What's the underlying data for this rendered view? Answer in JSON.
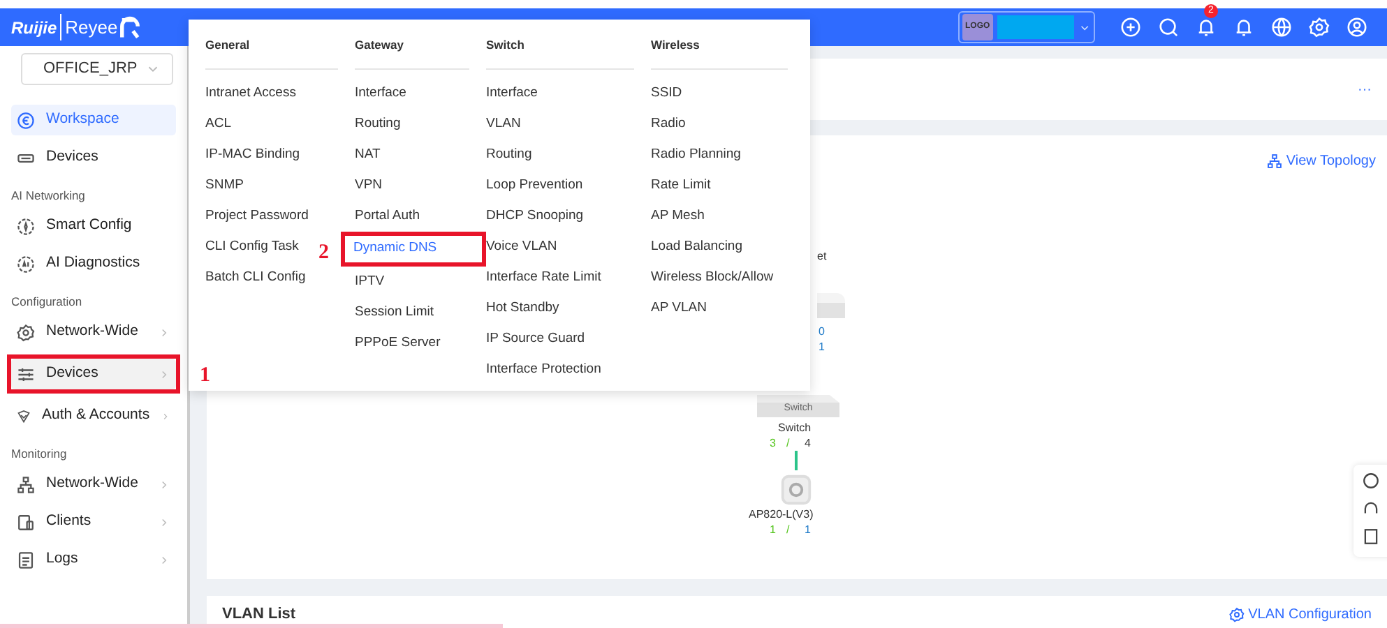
{
  "top_bar": {
    "brand": "Ruijie",
    "sub_brand": "Reyee",
    "logo_box": "LOGO",
    "notification_badge": "2"
  },
  "sidebar": {
    "project_select": {
      "value": "OFFICE_JRP"
    },
    "entries": [
      {
        "kind": "item",
        "label": "Workspace",
        "selected": true,
        "has_submenu": false
      },
      {
        "kind": "item",
        "label": "Devices",
        "selected": false,
        "has_submenu": false
      },
      {
        "kind": "section",
        "label": "AI Networking"
      },
      {
        "kind": "item",
        "label": "Smart Config",
        "selected": false,
        "has_submenu": false
      },
      {
        "kind": "item",
        "label": "AI Diagnostics",
        "selected": false,
        "has_submenu": false
      },
      {
        "kind": "section",
        "label": "Configuration"
      },
      {
        "kind": "item",
        "label": "Network-Wide",
        "selected": false,
        "has_submenu": true
      },
      {
        "kind": "item",
        "label": "Devices",
        "selected": false,
        "has_submenu": true,
        "annotation": "1"
      },
      {
        "kind": "item",
        "label": "Auth & Accounts",
        "selected": false,
        "has_submenu": true
      },
      {
        "kind": "section",
        "label": "Monitoring"
      },
      {
        "kind": "item",
        "label": "Network-Wide",
        "selected": false,
        "has_submenu": true
      },
      {
        "kind": "item",
        "label": "Clients",
        "selected": false,
        "has_submenu": true
      },
      {
        "kind": "item",
        "label": "Logs",
        "selected": false,
        "has_submenu": true
      }
    ]
  },
  "menu": {
    "columns": [
      {
        "title": "General",
        "items": [
          {
            "label": "Intranet Access",
            "selected": false
          },
          {
            "label": "ACL",
            "selected": false
          },
          {
            "label": "IP-MAC Binding",
            "selected": false
          },
          {
            "label": "SNMP",
            "selected": false
          },
          {
            "label": "Project Password",
            "selected": false
          },
          {
            "label": "CLI Config Task",
            "selected": false
          },
          {
            "label": "Batch CLI Config",
            "selected": false
          }
        ]
      },
      {
        "title": "Gateway",
        "items": [
          {
            "label": "Interface",
            "selected": false
          },
          {
            "label": "Routing",
            "selected": false
          },
          {
            "label": "NAT",
            "selected": false
          },
          {
            "label": "VPN",
            "selected": false
          },
          {
            "label": "Portal Auth",
            "selected": false
          },
          {
            "label": "Dynamic DNS",
            "selected": true,
            "annotation": "2"
          },
          {
            "label": "IPTV",
            "selected": false
          },
          {
            "label": "Session Limit",
            "selected": false
          },
          {
            "label": "PPPoE Server",
            "selected": false
          }
        ]
      },
      {
        "title": "Switch",
        "items": [
          {
            "label": "Interface",
            "selected": false
          },
          {
            "label": "VLAN",
            "selected": false
          },
          {
            "label": "Routing",
            "selected": false
          },
          {
            "label": "Loop Prevention",
            "selected": false
          },
          {
            "label": "DHCP Snooping",
            "selected": false
          },
          {
            "label": "Voice VLAN",
            "selected": false
          },
          {
            "label": "Interface Rate Limit",
            "selected": false
          },
          {
            "label": "Hot Standby",
            "selected": false
          },
          {
            "label": "IP Source Guard",
            "selected": false
          },
          {
            "label": "Interface Protection",
            "selected": false
          }
        ]
      },
      {
        "title": "Wireless",
        "items": [
          {
            "label": "SSID",
            "selected": false
          },
          {
            "label": "Radio",
            "selected": false
          },
          {
            "label": "Radio Planning",
            "selected": false
          },
          {
            "label": "Rate Limit",
            "selected": false
          },
          {
            "label": "AP Mesh",
            "selected": false
          },
          {
            "label": "Load Balancing",
            "selected": false
          },
          {
            "label": "Wireless Block/Allow",
            "selected": false
          },
          {
            "label": "AP VLAN",
            "selected": false
          }
        ]
      }
    ]
  },
  "main": {
    "more": "···",
    "topology_link": "View Topology",
    "topology": {
      "gateway": {
        "label_fragment": "et",
        "online": "0",
        "total": "1"
      },
      "switch": {
        "box_label": "Switch",
        "name": "Switch",
        "online": "3",
        "separator": "/",
        "total": "4"
      },
      "ap": {
        "name": "AP820-L(V3)",
        "online": "1",
        "separator": "/",
        "total": "1"
      }
    },
    "vlan_title": "VLAN List",
    "vlan_link": "VLAN Configuration"
  }
}
